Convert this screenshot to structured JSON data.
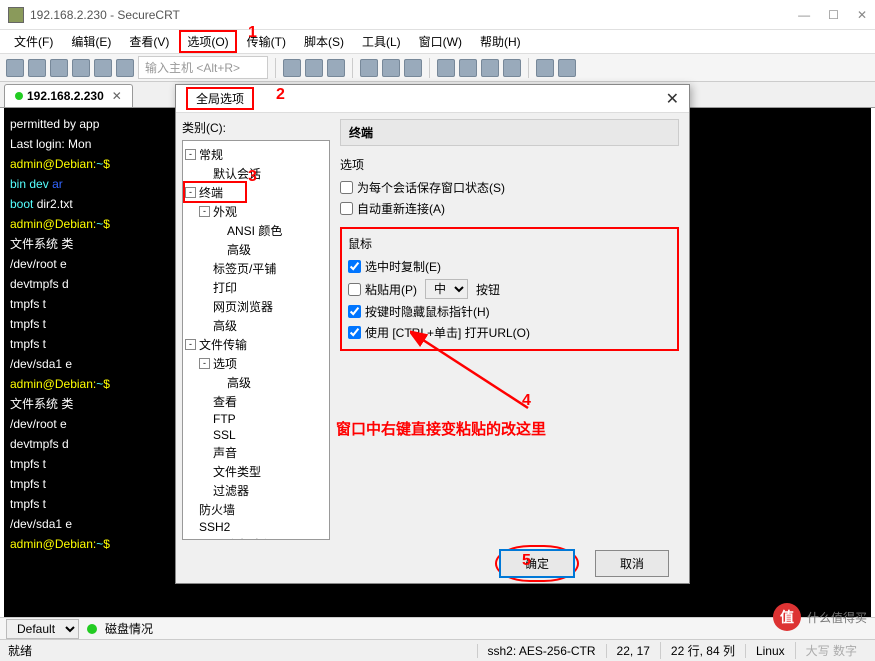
{
  "window": {
    "title": "192.168.2.230 - SecureCRT",
    "min": "—",
    "max": "☐",
    "close": "✕"
  },
  "menu": {
    "items": [
      "文件(F)",
      "编辑(E)",
      "查看(V)",
      "选项(O)",
      "传输(T)",
      "脚本(S)",
      "工具(L)",
      "窗口(W)",
      "帮助(H)"
    ],
    "hl_index": 3
  },
  "toolbar": {
    "host_placeholder": "输入主机  <Alt+R>"
  },
  "tab": {
    "label": "192.168.2.230",
    "close": "✕"
  },
  "terminal": {
    "lines": [
      {
        "t": "permitted by app"
      },
      {
        "t": "Last login: Mon "
      },
      {
        "p": "admin@Debian:",
        "d": "~",
        "s": "$"
      },
      {
        "raw": "<span class='cyn'>bin</span>   <span class='cyn'>dev</span>   <span class='blu'>                                       ar</span>"
      },
      {
        "raw": "<span class='cyn'>boot</span>  dir2.txt  "
      },
      {
        "p": "admin@Debian:",
        "d": "~",
        "s": "$"
      },
      {
        "t": "文件系统        类"
      },
      {
        "t": "/dev/root      e"
      },
      {
        "t": "devtmpfs       d"
      },
      {
        "t": "tmpfs          t"
      },
      {
        "t": "tmpfs          t"
      },
      {
        "t": "tmpfs          t"
      },
      {
        "t": "/dev/sda1      e"
      },
      {
        "p": "admin@Debian:",
        "d": "~",
        "s": "$ "
      },
      {
        "t": "文件系统        类"
      },
      {
        "t": "/dev/root      e"
      },
      {
        "t": "devtmpfs       d"
      },
      {
        "t": "tmpfs          t"
      },
      {
        "t": "tmpfs          t"
      },
      {
        "t": "tmpfs          t"
      },
      {
        "t": "/dev/sda1      e"
      },
      {
        "p": "admin@Debian:",
        "d": "~",
        "s": "$"
      }
    ]
  },
  "dialog": {
    "title": "全局选项",
    "close": "✕",
    "category_label": "类别(C):",
    "tree": [
      {
        "d": 0,
        "tog": "-",
        "l": "常规"
      },
      {
        "d": 1,
        "l": "默认会话"
      },
      {
        "d": 0,
        "tog": "-",
        "l": "终端",
        "hl": true
      },
      {
        "d": 1,
        "tog": "-",
        "l": "外观"
      },
      {
        "d": 2,
        "l": "ANSI 颜色"
      },
      {
        "d": 2,
        "l": "高级"
      },
      {
        "d": 1,
        "l": "标签页/平铺"
      },
      {
        "d": 1,
        "l": "打印"
      },
      {
        "d": 1,
        "l": "网页浏览器"
      },
      {
        "d": 1,
        "l": "高级"
      },
      {
        "d": 0,
        "tog": "-",
        "l": "文件传输"
      },
      {
        "d": 1,
        "tog": "-",
        "l": "选项"
      },
      {
        "d": 2,
        "l": "高级"
      },
      {
        "d": 1,
        "l": "查看"
      },
      {
        "d": 1,
        "l": "FTP"
      },
      {
        "d": 1,
        "l": "SSL"
      },
      {
        "d": 1,
        "l": "声音"
      },
      {
        "d": 1,
        "l": "文件类型"
      },
      {
        "d": 1,
        "l": "过滤器"
      },
      {
        "d": 0,
        "l": "防火墙"
      },
      {
        "d": 0,
        "l": "SSH2"
      },
      {
        "d": 0,
        "l": "SSH 主机密钥"
      }
    ],
    "panel_title": "终端",
    "group1": {
      "title": "选项",
      "opts": [
        {
          "c": false,
          "l": "为每个会话保存窗口状态(S)"
        },
        {
          "c": false,
          "l": "自动重新连接(A)"
        }
      ]
    },
    "group2": {
      "title": "鼠标",
      "opts": [
        {
          "c": true,
          "l": "选中时复制(E)"
        },
        {
          "c": false,
          "l": "粘贴用(P)",
          "sel": "中",
          "after": "按钮"
        },
        {
          "c": true,
          "l": "按键时隐藏鼠标指针(H)"
        },
        {
          "c": true,
          "l": "使用 [CTRL+单击] 打开URL(O)"
        }
      ]
    },
    "ok": "确定",
    "cancel": "取消"
  },
  "annotations": {
    "n1": "1",
    "n2": "2",
    "n3": "3",
    "n4": "4",
    "n5": "5",
    "note": "窗口中右键直接变粘贴的改这里"
  },
  "status2": {
    "default": "Default",
    "disk": "磁盘情况"
  },
  "status": {
    "ready": "就绪",
    "ssh": "ssh2: AES-256-CTR",
    "pos": "22,  17",
    "rc": "22 行, 84 列",
    "os": "Linux",
    "caps": "大写 数字"
  },
  "watermark": {
    "logo": "值",
    "text": "什么值得买"
  }
}
